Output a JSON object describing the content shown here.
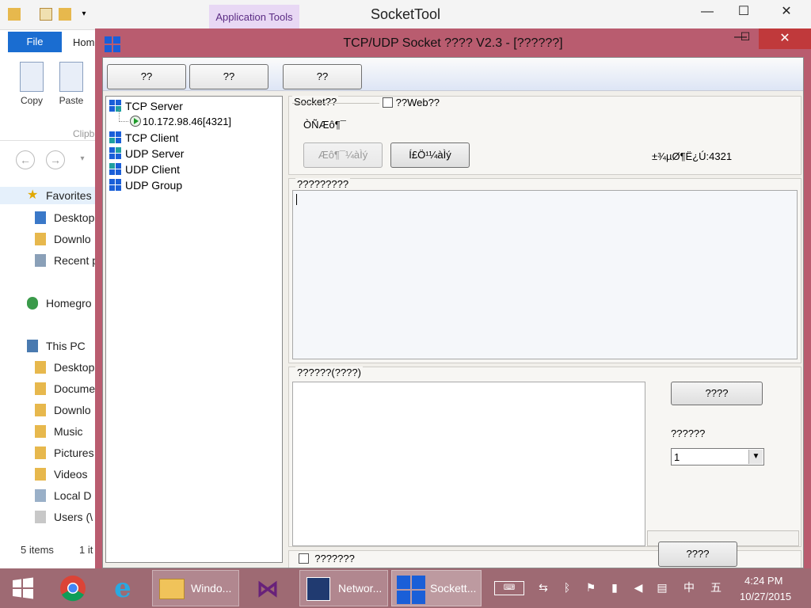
{
  "explorer": {
    "title": "SocketTool",
    "app_tools_tab": "Application Tools",
    "file_tab": "File",
    "home_tab": "Hom",
    "copy_label": "Copy",
    "paste_label": "Paste",
    "clipboard_group": "Clipb",
    "nav_items": [
      "Favorites",
      "Desktop",
      "Downlo",
      "Recent p",
      "Homegro",
      "This PC",
      "Desktop",
      "Docume",
      "Downlo",
      "Music",
      "Pictures",
      "Videos",
      "Local D",
      "Users (\\"
    ],
    "status_items": "5 items",
    "status_selected": "1 it"
  },
  "socket_tool": {
    "title": "TCP/UDP Socket ???? V2.3 - [??????]",
    "toolbar": {
      "btn1": "??",
      "btn2": "??",
      "btn3": "??"
    },
    "tree": {
      "tcp_server": "TCP Server",
      "tcp_server_child": "10.172.98.46[4321]",
      "tcp_client": "TCP Client",
      "udp_server": "UDP Server",
      "udp_client": "UDP Client",
      "udp_group": "UDP Group"
    },
    "socket_group": {
      "legend": "Socket??",
      "web_checkbox_label": "??Web??",
      "status_text": "ÒÑÆô¶¯",
      "start_button": "Æô¶¯¼àÌý",
      "stop_button": "Í£Ö¹¼àÌý",
      "port_text": "±¾µØ¶Ë¿Ú:4321"
    },
    "receive_group": {
      "legend": "?????????"
    },
    "send_group": {
      "legend": "??????(????)",
      "send_button": "????",
      "count_label": "??????",
      "count_value": "1",
      "checkbox_label": "???????",
      "bottom_button": "????"
    }
  },
  "taskbar": {
    "apps": [
      "Windo...",
      "Networ...",
      "Sockett..."
    ],
    "time": "4:24 PM",
    "date": "10/27/2015",
    "ime_1": "中",
    "ime_2": "五"
  },
  "colors": {
    "window_border": "#b95c6f",
    "taskbar": "#9e6a73",
    "close_button": "#c0393b",
    "file_tab": "#1a6dd1"
  }
}
